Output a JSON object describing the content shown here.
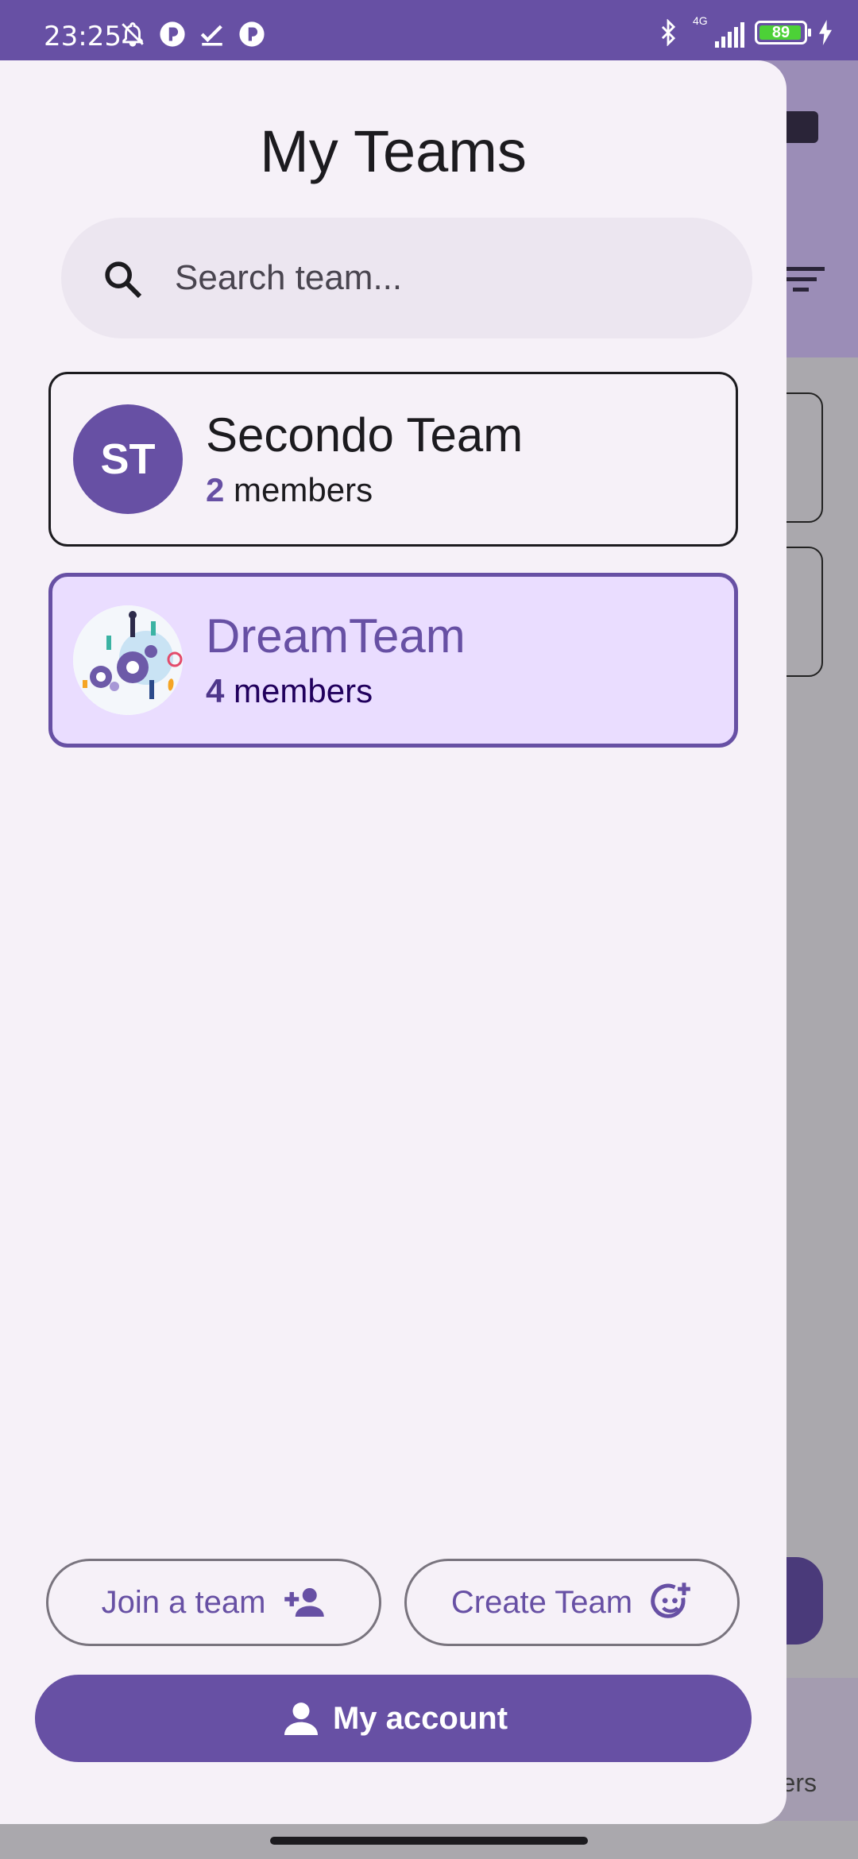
{
  "status_bar": {
    "time": "23:25",
    "left_icons": [
      "mute-bell-icon",
      "app-notification-icon",
      "check-icon",
      "app-notification-icon"
    ],
    "right_icons": [
      "bluetooth-icon",
      "4g-signal-icon",
      "battery-icon",
      "charging-icon"
    ],
    "network_label": "4G",
    "battery_level": "89"
  },
  "drawer": {
    "title": "My Teams",
    "search": {
      "placeholder": "Search team..."
    },
    "teams": [
      {
        "initials": "ST",
        "name": "Secondo Team",
        "member_count": "2",
        "member_label": "members",
        "selected": false
      },
      {
        "name": "DreamTeam",
        "member_count": "4",
        "member_label": "members",
        "selected": true,
        "avatar": "team-illustration-image"
      }
    ],
    "join_button": "Join a team",
    "create_button": "Create Team",
    "account_button": "My account"
  },
  "background": {
    "bottom_label_fragment": "ers"
  },
  "colors": {
    "primary": "#6750a4",
    "drawer_bg": "#f6f1f8",
    "selected_card_bg": "#eaddff",
    "scrim": "#aaa8ad"
  }
}
